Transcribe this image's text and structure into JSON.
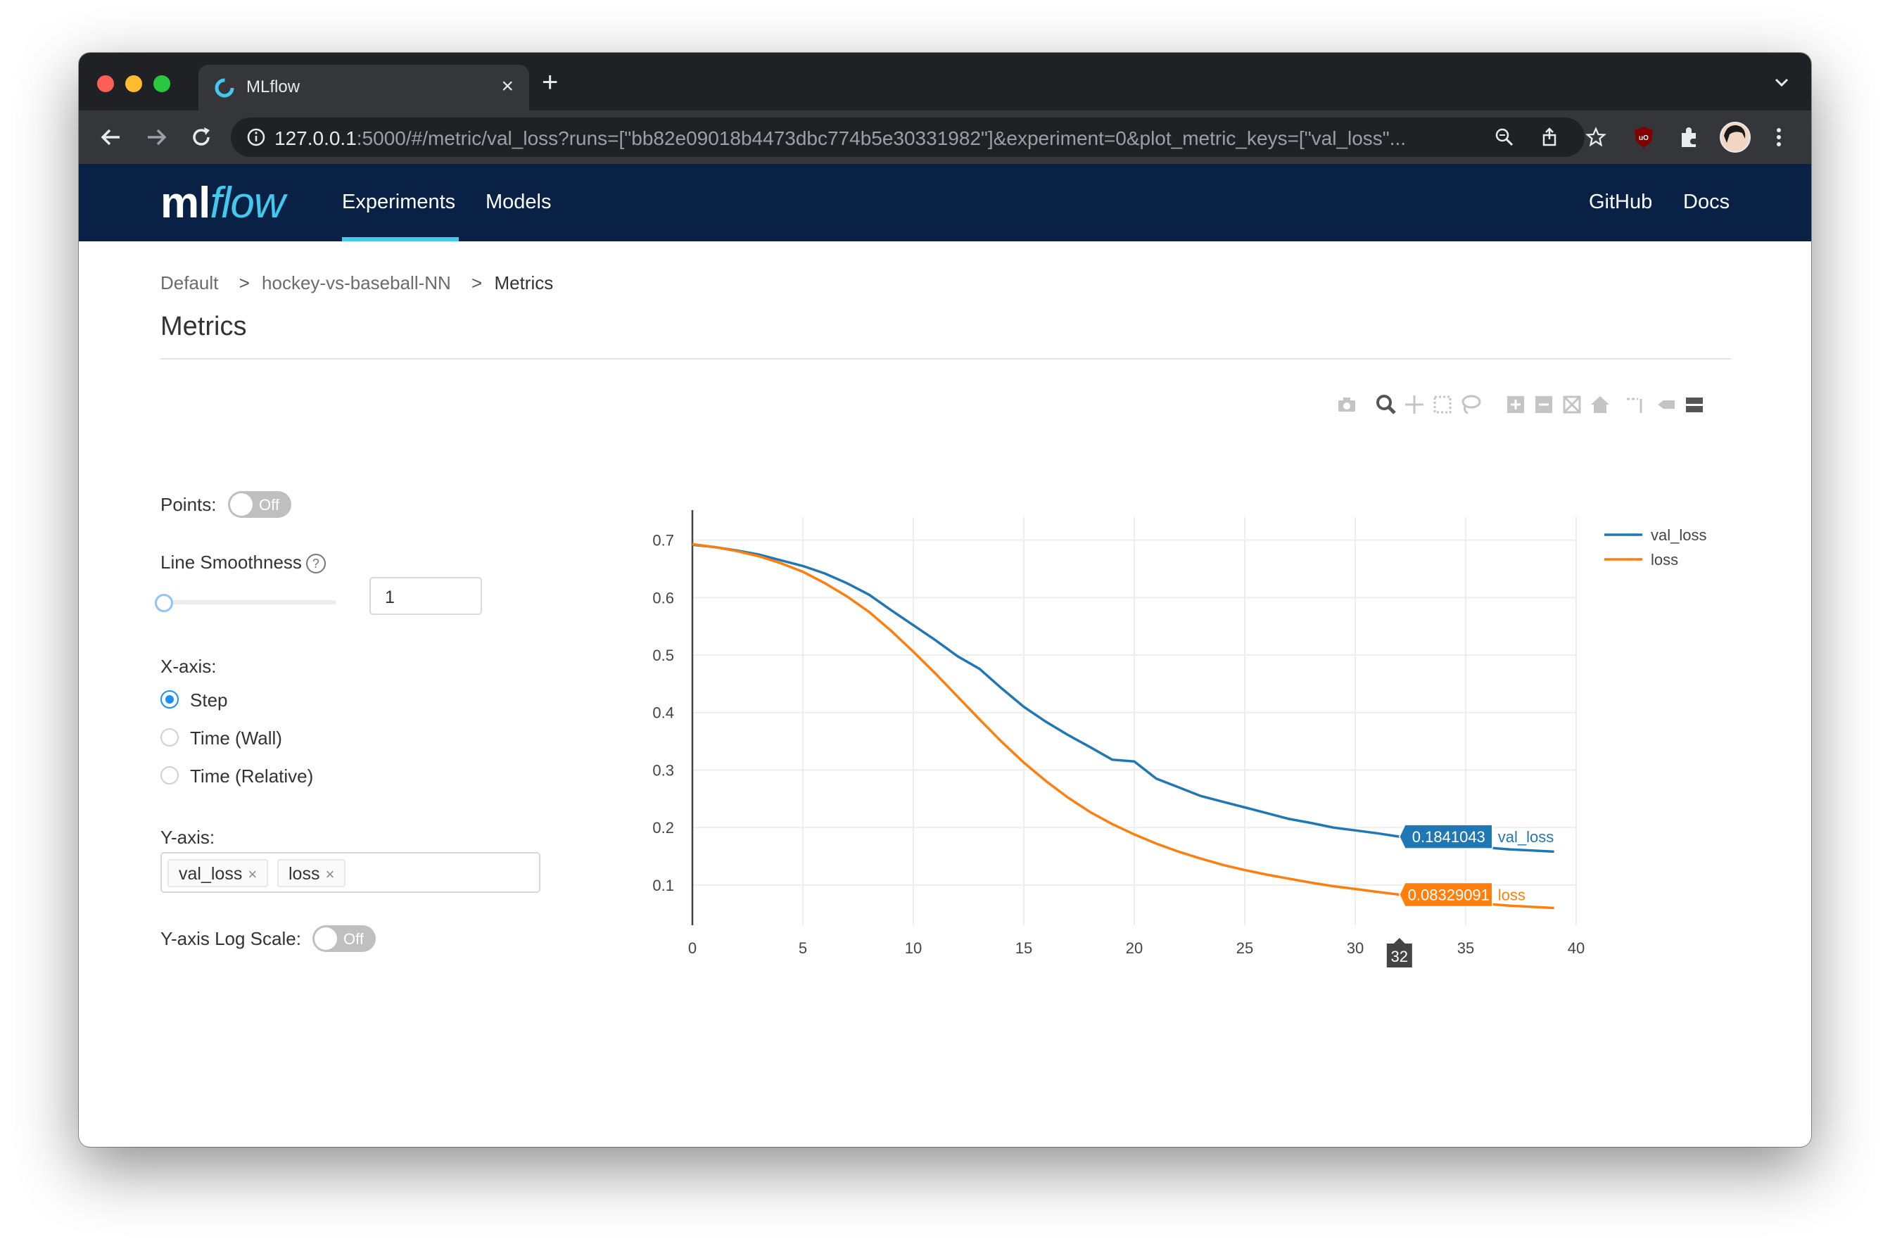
{
  "browser": {
    "tab_title": "MLflow",
    "tab_close": "×",
    "new_tab": "+",
    "url_host": "127.0.0.1",
    "url_rest": ":5000/#/metric/val_loss?runs=[\"bb82e09018b4473dbc774b5e30331982\"]&experiment=0&plot_metric_keys=[\"val_loss\"...",
    "icons": [
      "back-arrow-icon",
      "forward-arrow-icon",
      "reload-icon",
      "info-icon",
      "zoom-icon",
      "share-icon",
      "bookmark-star-icon",
      "ublock-icon",
      "extensions-icon",
      "profile-avatar",
      "kebab-menu-icon"
    ]
  },
  "header": {
    "logo_ml": "ml",
    "logo_flow": "flow",
    "nav": [
      "Experiments",
      "Models"
    ],
    "active_nav": "Experiments",
    "right_links": [
      "GitHub",
      "Docs"
    ],
    "accent_color": "#43c9ed",
    "background_color": "#082145"
  },
  "breadcrumb": {
    "items": [
      "Default",
      "hockey-vs-baseball-NN",
      "Metrics"
    ],
    "separator": ">"
  },
  "page": {
    "title": "Metrics"
  },
  "modebar_icons": [
    "camera-icon",
    "zoom-icon",
    "pan-icon",
    "box-select-icon",
    "lasso-icon",
    "zoom-in-icon",
    "zoom-out-icon",
    "autoscale-icon",
    "reset-axes-icon",
    "spike-lines-icon",
    "hover-closest-icon",
    "hover-compare-icon"
  ],
  "controls": {
    "points_label": "Points:",
    "points_toggle": "Off",
    "smoothness_label": "Line Smoothness",
    "help_icon": "?",
    "smoothness_value": "1",
    "smoothness_fraction": 0,
    "xaxis_label": "X-axis:",
    "xaxis_options": [
      "Step",
      "Time (Wall)",
      "Time (Relative)"
    ],
    "xaxis_selected": "Step",
    "yaxis_label": "Y-axis:",
    "yaxis_tags": [
      "val_loss",
      "loss"
    ],
    "tag_remove": "×",
    "log_scale_label": "Y-axis Log Scale:",
    "log_scale_toggle": "Off"
  },
  "chart_data": {
    "type": "line",
    "title": "",
    "xlabel": "",
    "ylabel": "",
    "xlim": [
      0,
      40
    ],
    "ylim": [
      0.03,
      0.74
    ],
    "x_ticks": [
      0,
      5,
      10,
      15,
      20,
      25,
      30,
      35,
      40
    ],
    "y_ticks": [
      0.1,
      0.2,
      0.3,
      0.4,
      0.5,
      0.6,
      0.7
    ],
    "grid": true,
    "legend_position": "top-right",
    "series": [
      {
        "name": "val_loss",
        "color": "#1f77b4",
        "x": [
          0,
          1,
          2,
          3,
          4,
          5,
          6,
          7,
          8,
          9,
          10,
          11,
          12,
          13,
          14,
          15,
          16,
          17,
          18,
          19,
          20,
          21,
          22,
          23,
          24,
          25,
          26,
          27,
          28,
          29,
          30,
          31,
          32,
          33,
          34,
          35,
          36,
          37,
          38,
          39
        ],
        "y": [
          0.692,
          0.688,
          0.682,
          0.675,
          0.665,
          0.655,
          0.642,
          0.625,
          0.605,
          0.578,
          0.552,
          0.526,
          0.498,
          0.476,
          0.442,
          0.41,
          0.384,
          0.361,
          0.34,
          0.318,
          0.315,
          0.285,
          0.27,
          0.255,
          0.245,
          0.235,
          0.225,
          0.215,
          0.208,
          0.2,
          0.195,
          0.19,
          0.1841043,
          0.178,
          0.173,
          0.168,
          0.165,
          0.162,
          0.16,
          0.158
        ]
      },
      {
        "name": "loss",
        "color": "#ff7f0e",
        "x": [
          0,
          1,
          2,
          3,
          4,
          5,
          6,
          7,
          8,
          9,
          10,
          11,
          12,
          13,
          14,
          15,
          16,
          17,
          18,
          19,
          20,
          21,
          22,
          23,
          24,
          25,
          26,
          27,
          28,
          29,
          30,
          31,
          32,
          33,
          34,
          35,
          36,
          37,
          38,
          39
        ],
        "y": [
          0.693,
          0.688,
          0.681,
          0.672,
          0.66,
          0.645,
          0.625,
          0.602,
          0.575,
          0.542,
          0.506,
          0.468,
          0.428,
          0.388,
          0.349,
          0.313,
          0.281,
          0.252,
          0.227,
          0.206,
          0.188,
          0.172,
          0.158,
          0.146,
          0.135,
          0.126,
          0.118,
          0.111,
          0.104,
          0.098,
          0.093,
          0.088,
          0.08329091,
          0.078,
          0.074,
          0.07,
          0.067,
          0.064,
          0.062,
          0.06
        ]
      }
    ],
    "hover": {
      "x": 32,
      "labels": [
        {
          "series": "val_loss",
          "value": "0.1841043"
        },
        {
          "series": "loss",
          "value": "0.08329091"
        }
      ],
      "x_label": "32"
    }
  }
}
